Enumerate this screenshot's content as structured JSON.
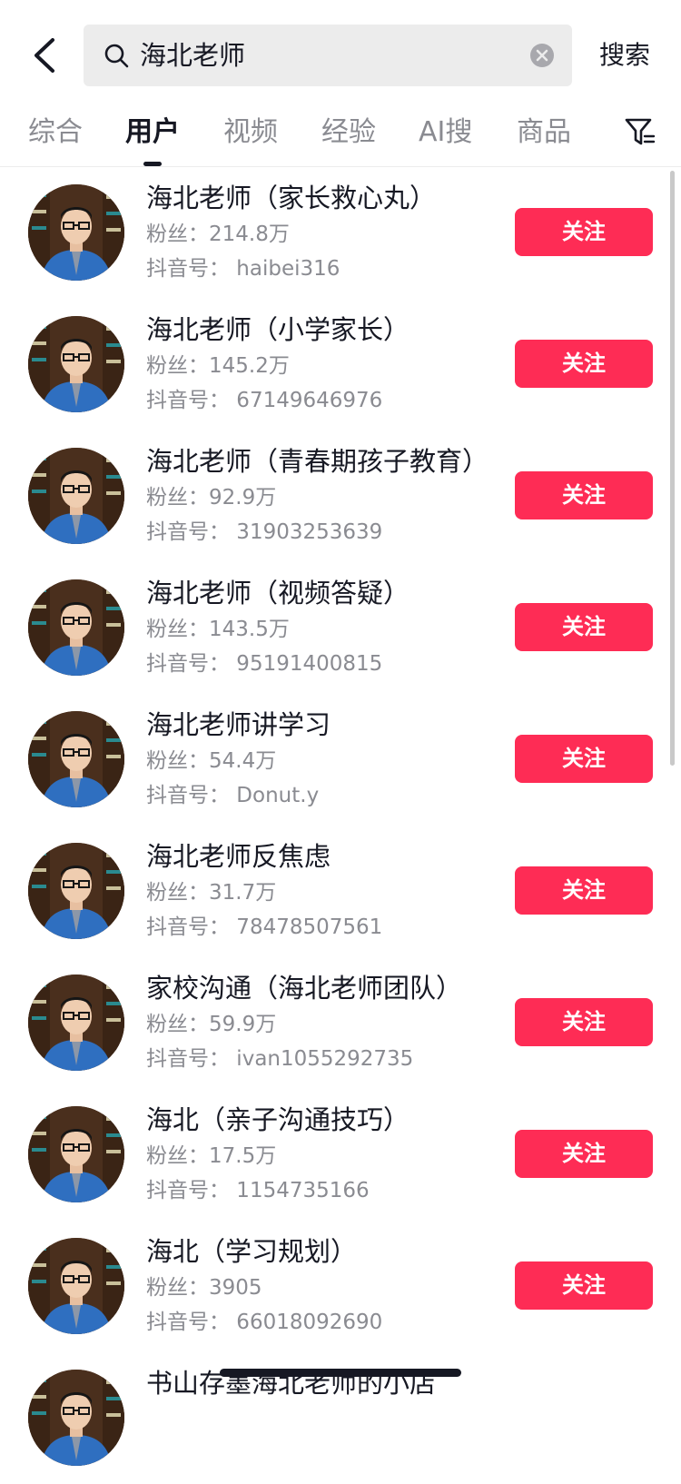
{
  "search": {
    "query": "海北老师",
    "search_label": "搜索"
  },
  "tabs": [
    {
      "label": "综合"
    },
    {
      "label": "用户"
    },
    {
      "label": "视频"
    },
    {
      "label": "经验"
    },
    {
      "label": "AI搜"
    },
    {
      "label": "商品"
    }
  ],
  "active_tab": "用户",
  "colors": {
    "accent": "#fe2c55",
    "text_primary": "#161823",
    "text_secondary": "#8a8b91",
    "search_bg": "#ececec"
  },
  "results": [
    {
      "name": "海北老师（家长救心丸）",
      "fans": "粉丝：214.8万",
      "uid": "抖音号：  haibei316",
      "follow": "关注"
    },
    {
      "name": "海北老师（小学家长）",
      "fans": "粉丝：145.2万",
      "uid": "抖音号：  67149646976",
      "follow": "关注"
    },
    {
      "name": "海北老师（青春期孩子教育）",
      "fans": "粉丝：92.9万",
      "uid": "抖音号：  31903253639",
      "follow": "关注"
    },
    {
      "name": "海北老师（视频答疑）",
      "fans": "粉丝：143.5万",
      "uid": "抖音号：  95191400815",
      "follow": "关注"
    },
    {
      "name": "海北老师讲学习",
      "fans": "粉丝：54.4万",
      "uid": "抖音号：  Donut.y",
      "follow": "关注"
    },
    {
      "name": "海北老师反焦虑",
      "fans": "粉丝：31.7万",
      "uid": "抖音号：  78478507561",
      "follow": "关注"
    },
    {
      "name": "家校沟通（海北老师团队）",
      "fans": "粉丝：59.9万",
      "uid": "抖音号：  ivan1055292735",
      "follow": "关注"
    },
    {
      "name": "海北（亲子沟通技巧）",
      "fans": "粉丝：17.5万",
      "uid": "抖音号：  1154735166",
      "follow": "关注"
    },
    {
      "name": "海北（学习规划）",
      "fans": "粉丝：3905",
      "uid": "抖音号：  66018092690",
      "follow": "关注"
    },
    {
      "name": "书山存墨海北老师的小店",
      "fans": "",
      "uid": "",
      "follow": ""
    }
  ]
}
